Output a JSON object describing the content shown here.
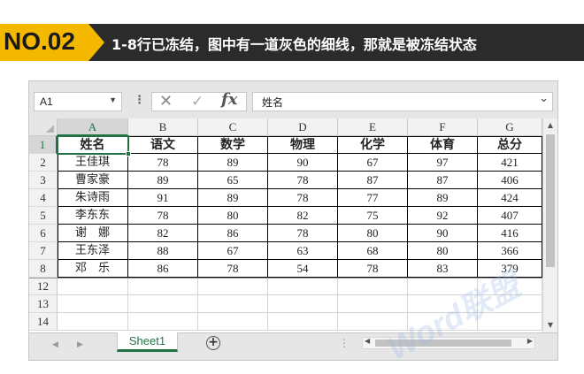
{
  "banner": {
    "tag": "NO.02",
    "text": "1-8行已冻结，图中有一道灰色的细线，那就是被冻结状态",
    "colors": {
      "tag": "#f5b800",
      "bar": "#2b2b2b"
    }
  },
  "formula_bar": {
    "name_box": "A1",
    "cancel_icon": "cancel-icon",
    "enter_icon": "checkmark-icon",
    "fx_label": "fx",
    "formula_value": "姓名"
  },
  "sheet": {
    "selected_cell": "A1",
    "frozen_rows": 8,
    "columns": [
      "A",
      "B",
      "C",
      "D",
      "E",
      "F",
      "G"
    ],
    "row_numbers": [
      "1",
      "2",
      "3",
      "4",
      "5",
      "6",
      "7",
      "8",
      "12",
      "13",
      "14"
    ],
    "header": [
      "姓名",
      "语文",
      "数学",
      "物理",
      "化学",
      "体育",
      "总分"
    ],
    "rows": [
      [
        "王佳琪",
        "78",
        "89",
        "90",
        "67",
        "97",
        "421"
      ],
      [
        "曹家豪",
        "89",
        "65",
        "78",
        "87",
        "87",
        "406"
      ],
      [
        "朱诗雨",
        "91",
        "89",
        "78",
        "77",
        "89",
        "424"
      ],
      [
        "李东东",
        "78",
        "80",
        "82",
        "75",
        "92",
        "407"
      ],
      [
        "谢　娜",
        "82",
        "86",
        "78",
        "80",
        "90",
        "416"
      ],
      [
        "王东泽",
        "88",
        "67",
        "63",
        "68",
        "80",
        "366"
      ],
      [
        "邓　乐",
        "86",
        "78",
        "54",
        "78",
        "83",
        "379"
      ]
    ]
  },
  "bottom_bar": {
    "sheet_tab": "Sheet1",
    "add_sheet": "+"
  },
  "watermark": "Word联盟",
  "colors": {
    "accent": "#217346",
    "freeze_line": "#9a9a9a"
  }
}
